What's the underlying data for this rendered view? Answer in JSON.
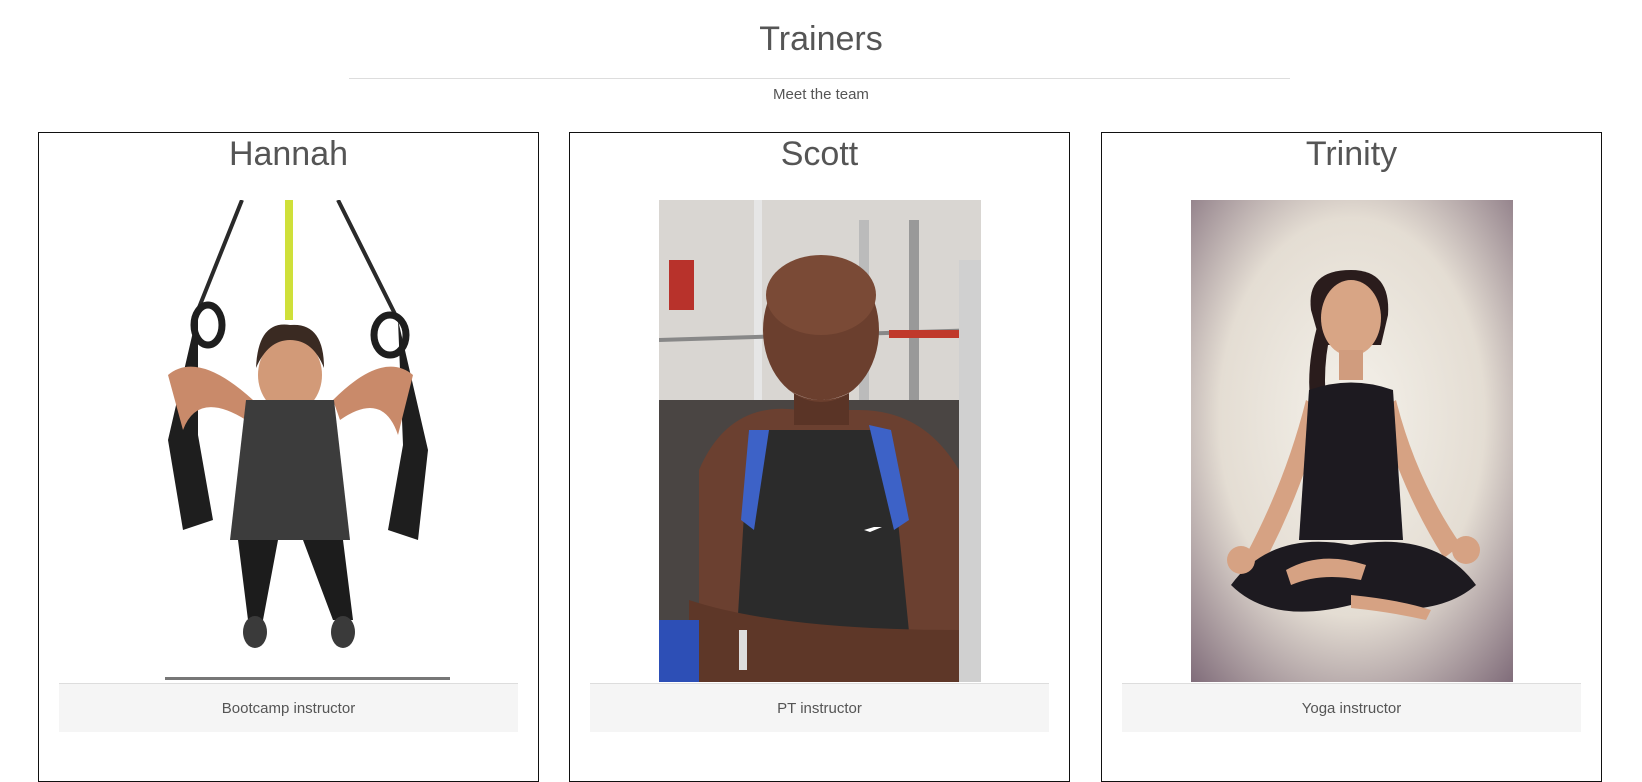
{
  "header": {
    "title": "Trainers",
    "subtitle": "Meet the team"
  },
  "trainers": [
    {
      "name": "Hannah",
      "role": "Bootcamp instructor",
      "photo_icon": "suspension-trainer-photo"
    },
    {
      "name": "Scott",
      "role": "PT instructor",
      "photo_icon": "gym-portrait-photo"
    },
    {
      "name": "Trinity",
      "role": "Yoga instructor",
      "photo_icon": "yoga-meditation-photo"
    }
  ],
  "colors": {
    "text": "#555555",
    "card_border": "#111111",
    "role_bar_bg": "#f5f5f5",
    "rule": "#dddddd"
  }
}
